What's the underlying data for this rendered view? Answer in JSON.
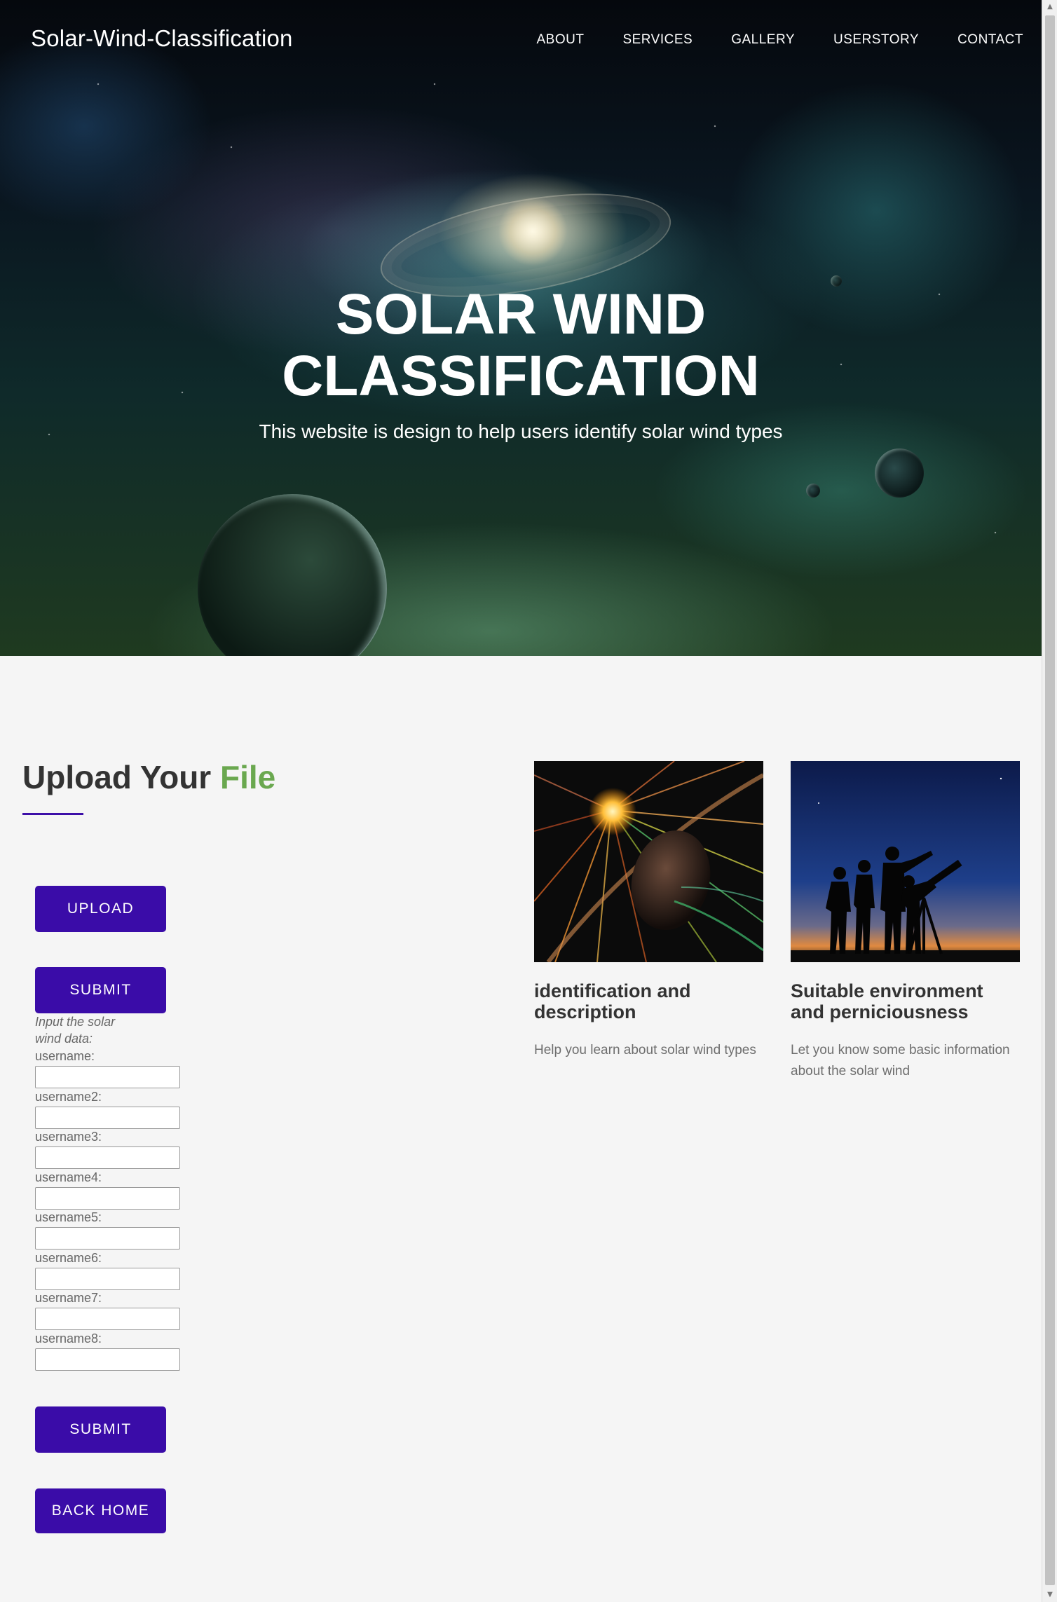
{
  "header": {
    "brand": "Solar-Wind-Classification",
    "nav": [
      "ABOUT",
      "SERVICES",
      "GALLERY",
      "USERSTORY",
      "CONTACT"
    ]
  },
  "hero": {
    "title_line1": "SOLAR WIND",
    "title_line2": "CLASSIFICATION",
    "subtitle": "This website is design to help users identify solar wind types"
  },
  "upload": {
    "title_main": "Upload Your",
    "title_accent": "File",
    "upload_button": "UPLOAD",
    "submit_button": "SUBMIT",
    "form_note": "Input the solar wind data:",
    "fields": [
      "username:",
      "username2:",
      "username3:",
      "username4:",
      "username5:",
      "username6:",
      "username7:",
      "username8:"
    ],
    "form_submit_button": "SUBMIT",
    "back_home_button": "BACK HOME"
  },
  "cards": [
    {
      "title": "identification and description",
      "text": "Help you learn about solar wind types",
      "icon": "solar-wind-planet-image"
    },
    {
      "title": "Suitable environment and perniciousness",
      "text": "Let you know some basic information about the solar wind",
      "icon": "stargazers-telescope-image"
    }
  ],
  "colors": {
    "button": "#3a0ca8",
    "accent": "#6aa84f",
    "underline": "#3d0fa8",
    "background": "#f5f5f5"
  }
}
